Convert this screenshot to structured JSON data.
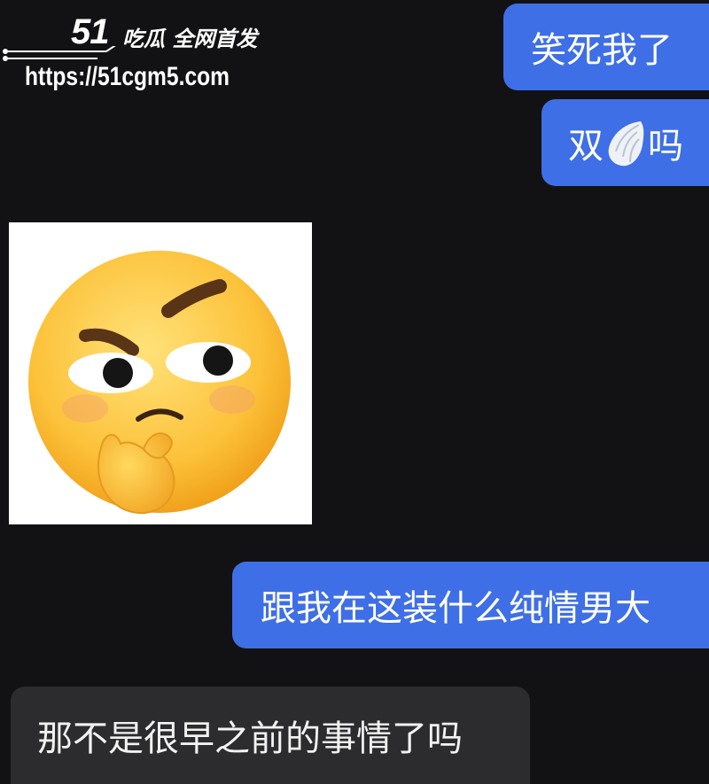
{
  "watermark": {
    "logo": "51",
    "tagline": "吃瓜 全网首发",
    "url": "https://51cgm5.com"
  },
  "messages": [
    {
      "direction": "sent",
      "text": "笑死我了"
    },
    {
      "direction": "sent",
      "text_before": "双",
      "icon": "wing-icon",
      "text_after": "吗"
    },
    {
      "direction": "received",
      "type": "sticker",
      "icon": "thinking-face-emoji"
    },
    {
      "direction": "sent",
      "text": "跟我在这装什么纯情男大"
    },
    {
      "direction": "received",
      "text": "那不是很早之前的事情了吗"
    }
  ],
  "colors": {
    "background": "#121214",
    "sent_bubble": "#3f6fe6",
    "received_bubble": "#2c2c2f",
    "text": "#ffffff"
  }
}
